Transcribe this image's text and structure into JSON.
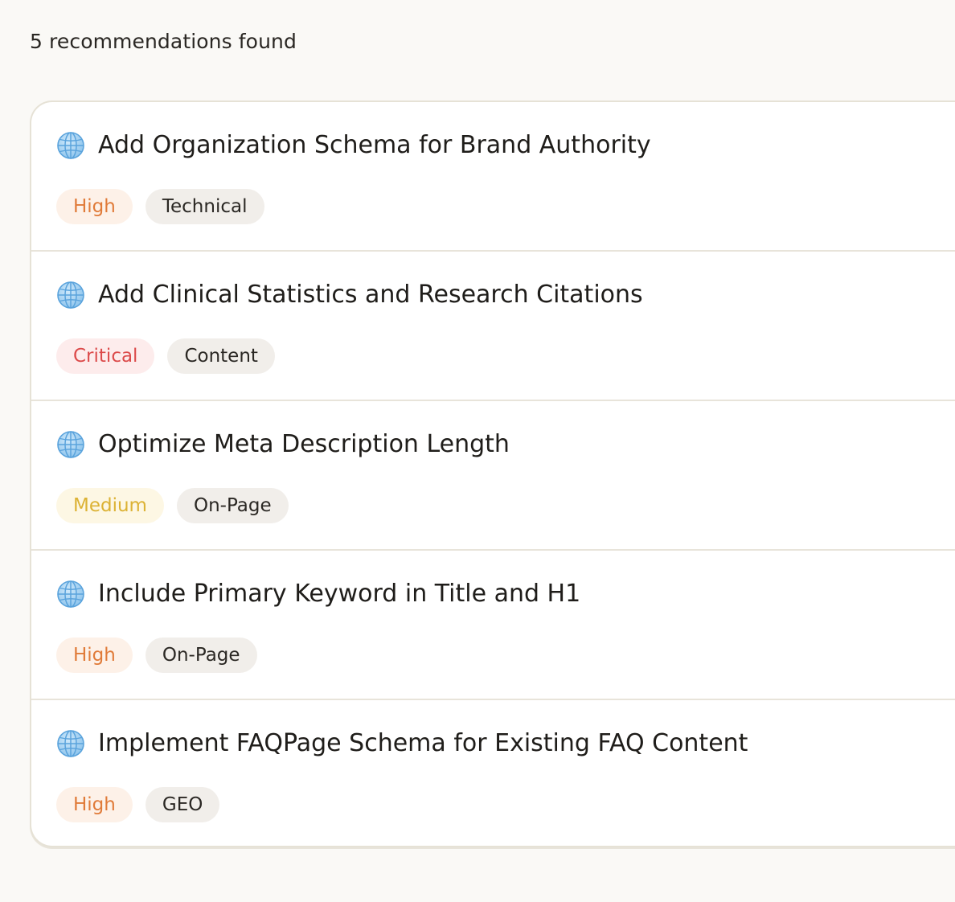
{
  "summary": {
    "count_text": "5 recommendations found"
  },
  "colors": {
    "priority": {
      "High": {
        "text": "#e07b39",
        "bg": "#fdf1e8"
      },
      "Critical": {
        "text": "#dc4b4b",
        "bg": "#fdecec"
      },
      "Medium": {
        "text": "#dcb234",
        "bg": "#fdf7e4"
      }
    }
  },
  "recommendations": [
    {
      "icon": "globe-icon",
      "title": "Add Organization Schema for Brand Authority",
      "priority": "High",
      "category": "Technical"
    },
    {
      "icon": "globe-icon",
      "title": "Add Clinical Statistics and Research Citations",
      "priority": "Critical",
      "category": "Content"
    },
    {
      "icon": "globe-icon",
      "title": "Optimize Meta Description Length",
      "priority": "Medium",
      "category": "On-Page"
    },
    {
      "icon": "globe-icon",
      "title": "Include Primary Keyword in Title and H1",
      "priority": "High",
      "category": "On-Page"
    },
    {
      "icon": "globe-icon",
      "title": "Implement FAQPage Schema for Existing FAQ Content",
      "priority": "High",
      "category": "GEO"
    }
  ]
}
